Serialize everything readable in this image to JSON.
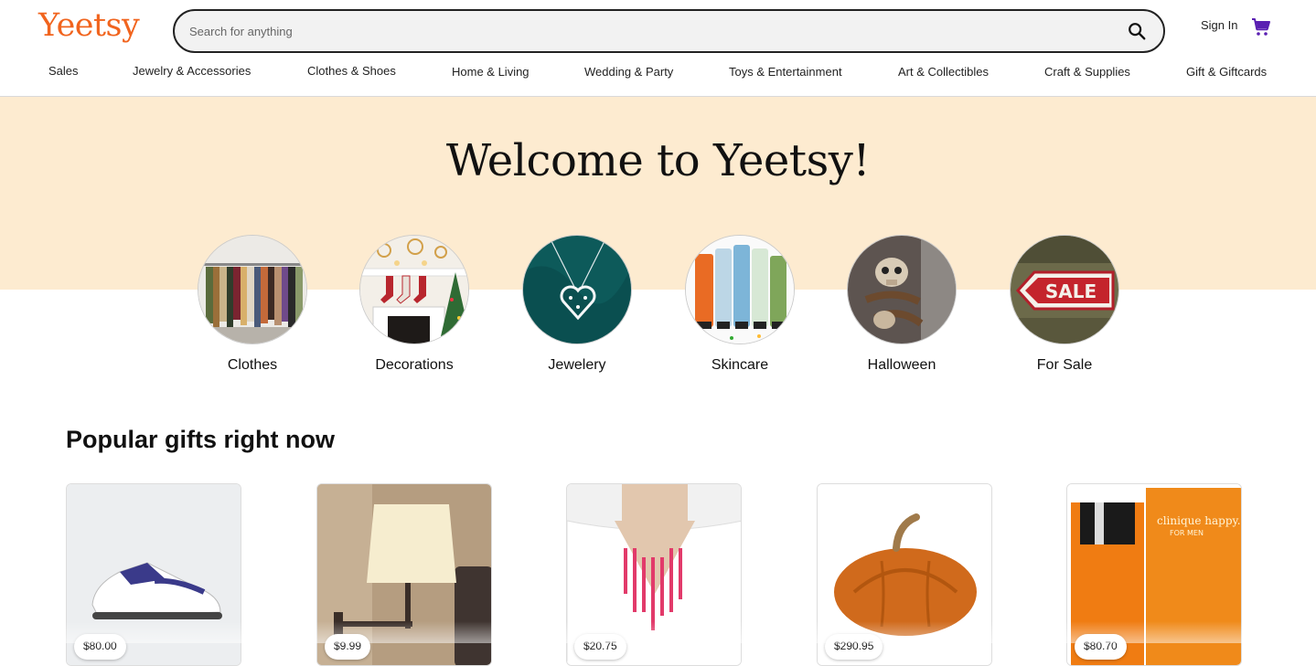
{
  "header": {
    "logo": "Yeetsy",
    "search_placeholder": "Search for anything",
    "signin": "Sign In",
    "nav": [
      "Sales",
      "Jewelry & Accessories",
      "Clothes & Shoes",
      "Home & Living",
      "Wedding & Party",
      "Toys & Entertainment",
      "Art & Collectibles",
      "Craft & Supplies",
      "Gift & Giftcards"
    ]
  },
  "banner": {
    "welcome": "Welcome to Yeetsy!"
  },
  "categories": [
    {
      "label": "Clothes",
      "icon": "clothes-rack-image"
    },
    {
      "label": "Decorations",
      "icon": "fireplace-stockings-image"
    },
    {
      "label": "Jewelery",
      "icon": "heart-necklace-image"
    },
    {
      "label": "Skincare",
      "icon": "skincare-tubes-image"
    },
    {
      "label": "Halloween",
      "icon": "skull-decoration-image"
    },
    {
      "label": "For Sale",
      "icon": "sale-sign-image",
      "sign_text": "SALE"
    }
  ],
  "popular": {
    "title": "Popular gifts right now",
    "products": [
      {
        "name": "sneaker",
        "price": "$80.00"
      },
      {
        "name": "wall-lamp",
        "price": "$9.99"
      },
      {
        "name": "necklace",
        "price": "$20.75"
      },
      {
        "name": "pumpkin-pot",
        "price": "$290.95"
      },
      {
        "name": "cologne",
        "price": "$80.70",
        "brand_text": "clinique happy.",
        "brand_sub": "FOR MEN"
      }
    ]
  },
  "colors": {
    "brand": "#f1641e",
    "banner": "#fdebd0",
    "cart": "#5a1fb2"
  }
}
